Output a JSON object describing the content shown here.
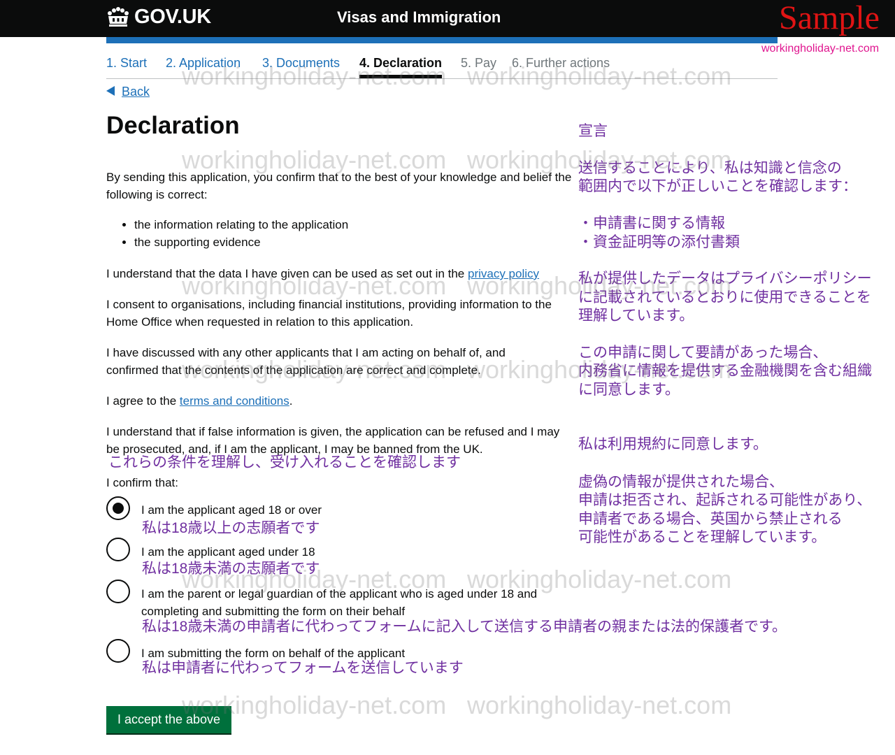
{
  "header": {
    "logo_text": "GOV.UK",
    "service_name": "Visas and Immigration",
    "sample_label": "Sample",
    "site_url": "workingholiday-net.com"
  },
  "steps": [
    {
      "label": "1. Start"
    },
    {
      "label": "2. Application"
    },
    {
      "label": "3. Documents"
    },
    {
      "label": "4. Declaration"
    },
    {
      "label": "5. Pay"
    },
    {
      "label": "6. Further actions"
    }
  ],
  "back_label": "Back",
  "title": "Declaration",
  "intro": "By sending this application, you confirm that to the best of your knowledge and belief the following is correct:",
  "bullets": [
    "the information relating to the application",
    "the supporting evidence"
  ],
  "privacy_text": "I understand that the data I have given can be used as set out in the ",
  "privacy_link": "privacy policy",
  "consent_text": "I consent to organisations, including financial institutions, providing information to the Home Office when requested in relation to this application.",
  "discussed_text": "I have discussed with any other applicants that I am acting on behalf of, and confirmed that the contents of the application are correct and complete.",
  "agree_text": "I agree to the ",
  "terms_link": "terms and conditions",
  "agree_end": ".",
  "false_info_text": "I understand that if false information is given, the application can be refused and I may be prosecuted, and, if I am the applicant, I may be banned from the UK.",
  "confirm_heading_jp": "これらの条件を理解し、受け入れることを確認します",
  "confirm_label": "I confirm that:",
  "options": [
    {
      "label": "I am the applicant aged 18 or over",
      "jp": "私は18歳以上の志願者です",
      "selected": true
    },
    {
      "label": "I am the applicant aged under 18",
      "jp": "私は18歳未満の志願者です",
      "selected": false
    },
    {
      "label": "I am the parent or legal guardian of the applicant who is aged under 18 and completing and submitting the form on their behalf",
      "jp": "私は18歳未満の申請者に代わってフォームに記入して送信する申請者の親または法的保護者です。",
      "selected": false
    },
    {
      "label": "I am submitting the form on behalf of the applicant",
      "jp": "私は申請者に代わってフォームを送信しています",
      "selected": false
    }
  ],
  "submit_label": "I accept the above",
  "jp_translations": {
    "title": "宣言",
    "intro_1": "送信することにより、私は知識と信念の",
    "intro_2": "範囲内で以下が正しいことを確認します：",
    "bullet_1": "・申請書に関する情報",
    "bullet_2": "・資金証明等の添付書類",
    "privacy_1": "私が提供したデータはプライバシーポリシー",
    "privacy_2": "に記載されているとおりに使用できることを",
    "privacy_3": "理解しています。",
    "consent_1": "この申請に関して要請があった場合、",
    "consent_2": "内務省に情報を提供する金融機関を含む組織",
    "consent_3": "に同意します。",
    "terms": "私は利用規約に同意します。",
    "false_1": "虚偽の情報が提供された場合、",
    "false_2": "申請は拒否され、起訴される可能性があり、",
    "false_3": "申請者である場合、英国から禁止される",
    "false_4": "可能性があることを理解しています。"
  },
  "watermark": "workingholiday-net.com",
  "colors": {
    "link": "#1d70b8",
    "button": "#00703c",
    "header": "#0b0c0c",
    "annotation": "#7030a0"
  }
}
